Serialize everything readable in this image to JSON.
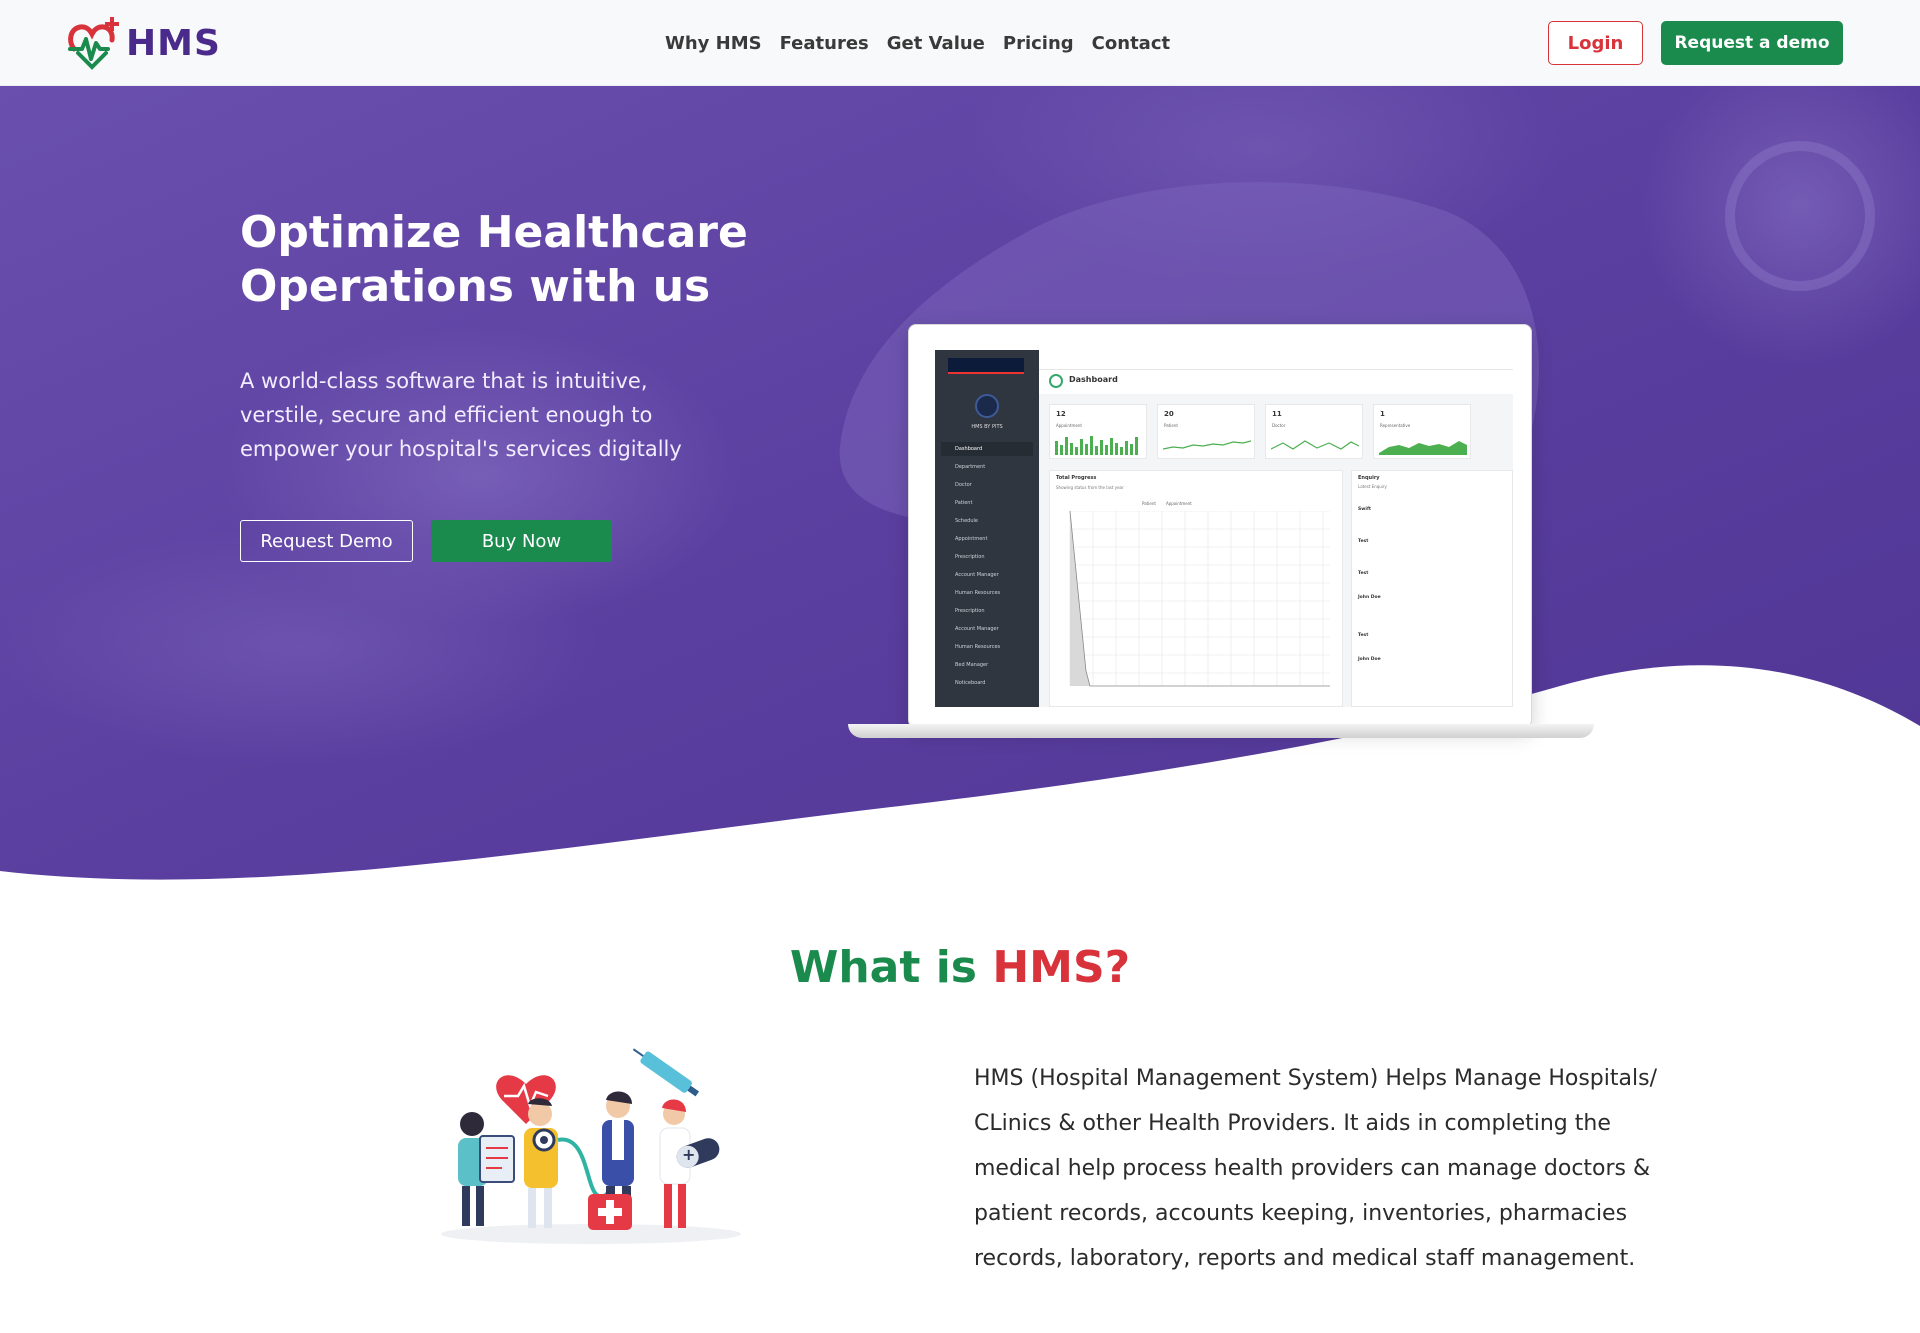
{
  "brand": {
    "name": "HMS"
  },
  "nav": {
    "links": [
      "Why HMS",
      "Features",
      "Get Value",
      "Pricing",
      "Contact"
    ],
    "login_label": "Login",
    "demo_label": "Request a demo"
  },
  "hero": {
    "title": "Optimize Healthcare Operations with us",
    "subtitle": "A world-class software that is intuitive, verstile, secure and efficient enough to empower your hospital's services digitally",
    "btn_request_demo": "Request Demo",
    "btn_buy_now": "Buy Now"
  },
  "mockup": {
    "sidebar_name": "HMS BY PITS",
    "sidebar_items": [
      "Dashboard",
      "Department",
      "Doctor",
      "Patient",
      "Schedule",
      "Appointment",
      "Prescription",
      "Account Manager",
      "Human Resources",
      "Prescription",
      "Account Manager",
      "Human Resources",
      "Bed Manager",
      "Noticeboard"
    ],
    "dashboard_title": "Dashboard",
    "cards": [
      {
        "num": "12",
        "label": "Appointment"
      },
      {
        "num": "20",
        "label": "Patient"
      },
      {
        "num": "11",
        "label": "Doctor"
      },
      {
        "num": "1",
        "label": "Representative"
      }
    ],
    "progress_title": "Total Progress",
    "progress_sub": "Showing status from the last year",
    "legend": [
      "Patient",
      "Appointment"
    ],
    "enquiry_title": "Enquiry",
    "enquiry_sub": "Latest Enquiry",
    "enquiries": [
      "Swift",
      "Test",
      "Test",
      "John Doe",
      "Test",
      "John Doe"
    ]
  },
  "what": {
    "title_part1": "What is",
    "title_part2": "HMS?",
    "body": "HMS (Hospital Management System) Helps Manage Hospitals/ CLinics & other Health Providers. It aids in completing the medical help process health providers can manage doctors & patient records, accounts keeping, inventories, pharmacies records, laboratory, reports and medical staff management."
  },
  "colors": {
    "brand_purple": "#4a2a8a",
    "hero_purple": "#5b3fa0",
    "green": "#1a8a4d",
    "red": "#d8323a"
  }
}
